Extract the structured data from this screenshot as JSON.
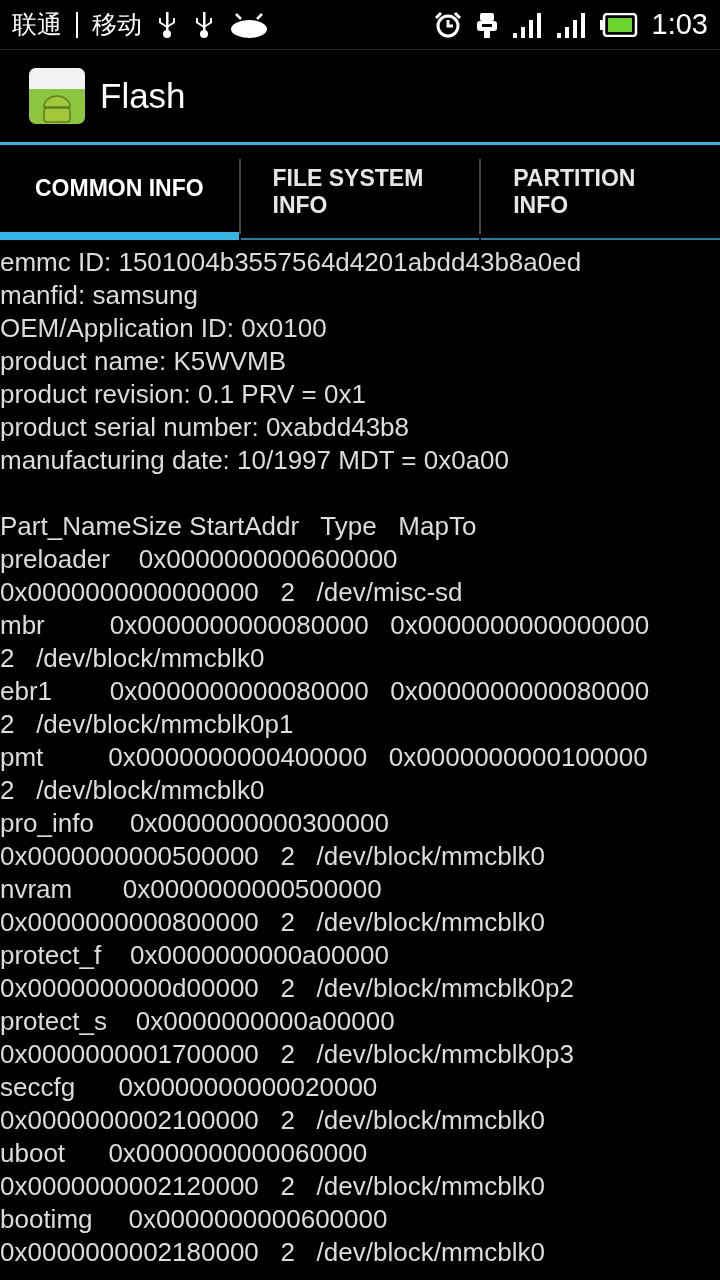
{
  "status_bar": {
    "carriers": [
      "联通",
      "移动"
    ],
    "time": "1:03"
  },
  "action_bar": {
    "title": "Flash"
  },
  "tabs": [
    {
      "label": "COMMON INFO",
      "selected": true
    },
    {
      "label": "FILE SYSTEM INFO",
      "selected": false
    },
    {
      "label": "PARTITION INFO",
      "selected": false
    }
  ],
  "common_info": {
    "lines": [
      "emmc ID: 1501004b3557564d4201abdd43b8a0ed",
      "manfid: samsung",
      "OEM/Application ID: 0x0100",
      "product name: K5WVMB",
      "product revision: 0.1 PRV = 0x1",
      "product serial number: 0xabdd43b8",
      "manufacturing date: 10/1997 MDT = 0x0a00"
    ]
  },
  "partition_table": {
    "lines": [
      "Part_NameSize StartAddr   Type   MapTo",
      "preloader    0x0000000000600000",
      "0x0000000000000000   2   /dev/misc-sd",
      "mbr         0x0000000000080000   0x0000000000000000",
      "2   /dev/block/mmcblk0",
      "ebr1        0x0000000000080000   0x0000000000080000",
      "2   /dev/block/mmcblk0p1",
      "pmt         0x0000000000400000   0x0000000000100000",
      "2   /dev/block/mmcblk0",
      "pro_info     0x0000000000300000",
      "0x0000000000500000   2   /dev/block/mmcblk0",
      "nvram       0x0000000000500000",
      "0x0000000000800000   2   /dev/block/mmcblk0",
      "protect_f    0x0000000000a00000",
      "0x0000000000d00000   2   /dev/block/mmcblk0p2",
      "protect_s    0x0000000000a00000",
      "0x0000000001700000   2   /dev/block/mmcblk0p3",
      "seccfg      0x0000000000020000",
      "0x0000000002100000   2   /dev/block/mmcblk0",
      "uboot      0x0000000000060000",
      "0x0000000002120000   2   /dev/block/mmcblk0",
      "bootimg     0x0000000000600000",
      "0x0000000002180000   2   /dev/block/mmcblk0"
    ]
  }
}
